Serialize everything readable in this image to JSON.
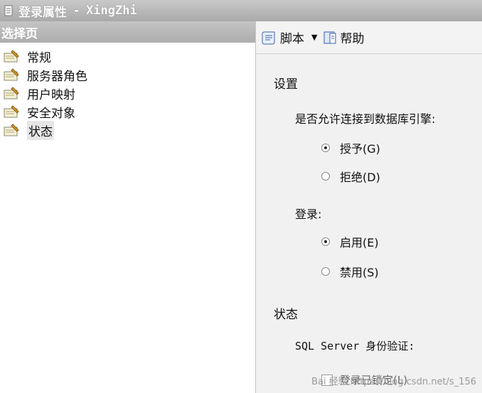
{
  "window": {
    "title": "登录属性",
    "separator": "-",
    "login_name": "XingZhi"
  },
  "left_panel": {
    "header": "选择页",
    "items": [
      {
        "label": "常规",
        "selected": false
      },
      {
        "label": "服务器角色",
        "selected": false
      },
      {
        "label": "用户映射",
        "selected": false
      },
      {
        "label": "安全对象",
        "selected": false
      },
      {
        "label": "状态",
        "selected": true
      }
    ]
  },
  "toolbar": {
    "script_label": "脚本",
    "help_label": "帮助"
  },
  "settings": {
    "section_title": "设置",
    "db_engine_question": "是否允许连接到数据库引擎:",
    "grant_label": "授予(G)",
    "deny_label": "拒绝(D)",
    "db_engine_selected": "grant",
    "login_question": "登录:",
    "enable_label": "启用(E)",
    "disable_label": "禁用(S)",
    "login_selected": "enable"
  },
  "status": {
    "section_title": "状态",
    "sql_auth_label": "SQL Server 身份验证:",
    "locked_label": "登录已锁定(L)",
    "locked_checked": false
  },
  "watermark": "Bai 经验 https://blog.csdn.net/s_156",
  "colors": {
    "titlebar": "#b5b5b5",
    "left_panel_bg": "#ffffff",
    "right_panel_bg": "#f1f1f1",
    "selected_item_bg": "#e6e6e6"
  }
}
